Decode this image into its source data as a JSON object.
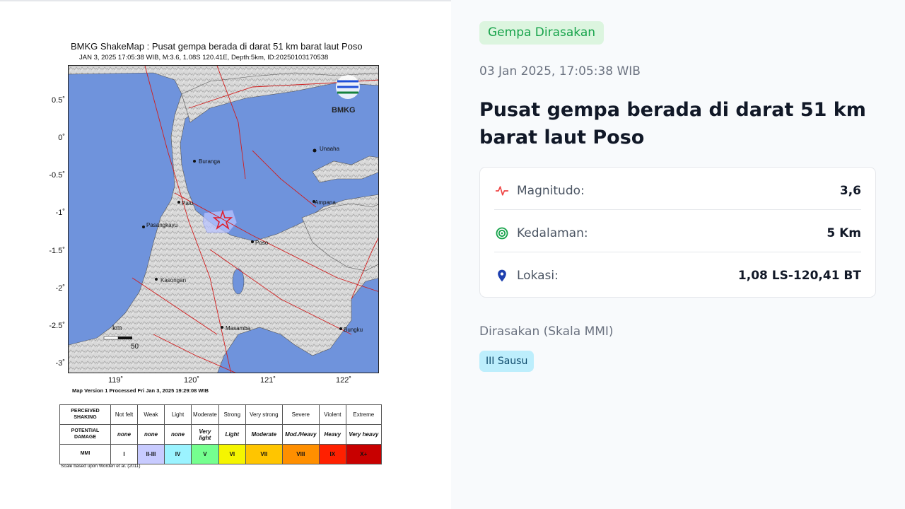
{
  "map": {
    "title": "BMKG ShakeMap : Pusat gempa berada di darat 51 km barat laut Poso",
    "subtitle": "JAN 3, 2025 17:05:38 WIB, M:3.6, 1.08S 120.41E, Depth:5km, ID:20250103170538",
    "version": "Map Version 1 Processed Fri Jan  3, 2025 19:29:08 WIB",
    "logo_text": "BMKG",
    "lat_ticks": [
      "0.5˚",
      "0˚",
      "-0.5˚",
      "-1˚",
      "-1.5˚",
      "-2˚",
      "-2.5˚",
      "-3˚"
    ],
    "lon_ticks": [
      "119˚",
      "120˚",
      "121˚",
      "122˚"
    ],
    "places": [
      {
        "name": "Unaaha"
      },
      {
        "name": "Buranga"
      },
      {
        "name": "Palu"
      },
      {
        "name": "Ampana"
      },
      {
        "name": "Pasangkayu"
      },
      {
        "name": "Poso"
      },
      {
        "name": "Kasongan"
      },
      {
        "name": "Masamba"
      },
      {
        "name": "Bungku"
      }
    ],
    "scalebar_unit": "km",
    "scalebar_value": "50",
    "scale_note": "Scale based upon Worden et al. (2011)",
    "legend": {
      "row_labels": [
        "PERCEIVED SHAKING",
        "POTENTIAL DAMAGE",
        "MMI"
      ],
      "shaking": [
        "Not felt",
        "Weak",
        "Light",
        "Moderate",
        "Strong",
        "Very strong",
        "Severe",
        "Violent",
        "Extreme"
      ],
      "damage": [
        "none",
        "none",
        "none",
        "Very light",
        "Light",
        "Moderate",
        "Mod./Heavy",
        "Heavy",
        "Very heavy"
      ],
      "mmi": [
        "I",
        "II-III",
        "IV",
        "V",
        "VI",
        "VII",
        "VIII",
        "IX",
        "X+"
      ],
      "mmi_colors": [
        "#ffffff",
        "#c8cbff",
        "#9bf3ff",
        "#75ff8f",
        "#f5f500",
        "#ffc500",
        "#ff8f00",
        "#ff2000",
        "#c80000"
      ]
    },
    "colors": {
      "sea": "#6f93dc",
      "land": "#d8d8d8",
      "fault": "#d11d1d",
      "epicenter": "#e11d2a"
    }
  },
  "info": {
    "badge": "Gempa Dirasakan",
    "datetime": "03 Jan 2025, 17:05:38 WIB",
    "headline": "Pusat gempa berada di darat 51 km barat laut Poso",
    "rows": [
      {
        "icon": "activity-icon",
        "label": "Magnitudo:",
        "value": "3,6"
      },
      {
        "icon": "target-icon",
        "label": "Kedalaman:",
        "value": "5 Km"
      },
      {
        "icon": "location-pin-icon",
        "label": "Lokasi:",
        "value": "1,08 LS-120,41 BT"
      }
    ],
    "felt_title": "Dirasakan (Skala MMI)",
    "felt_value": "III Sausu",
    "colors": {
      "badge_bg": "#dcf5df",
      "badge_text": "#16a34a",
      "mmi_bg": "#bdeefc",
      "activity": "#ef4444",
      "target": "#16a34a",
      "pin": "#1e40af"
    }
  }
}
